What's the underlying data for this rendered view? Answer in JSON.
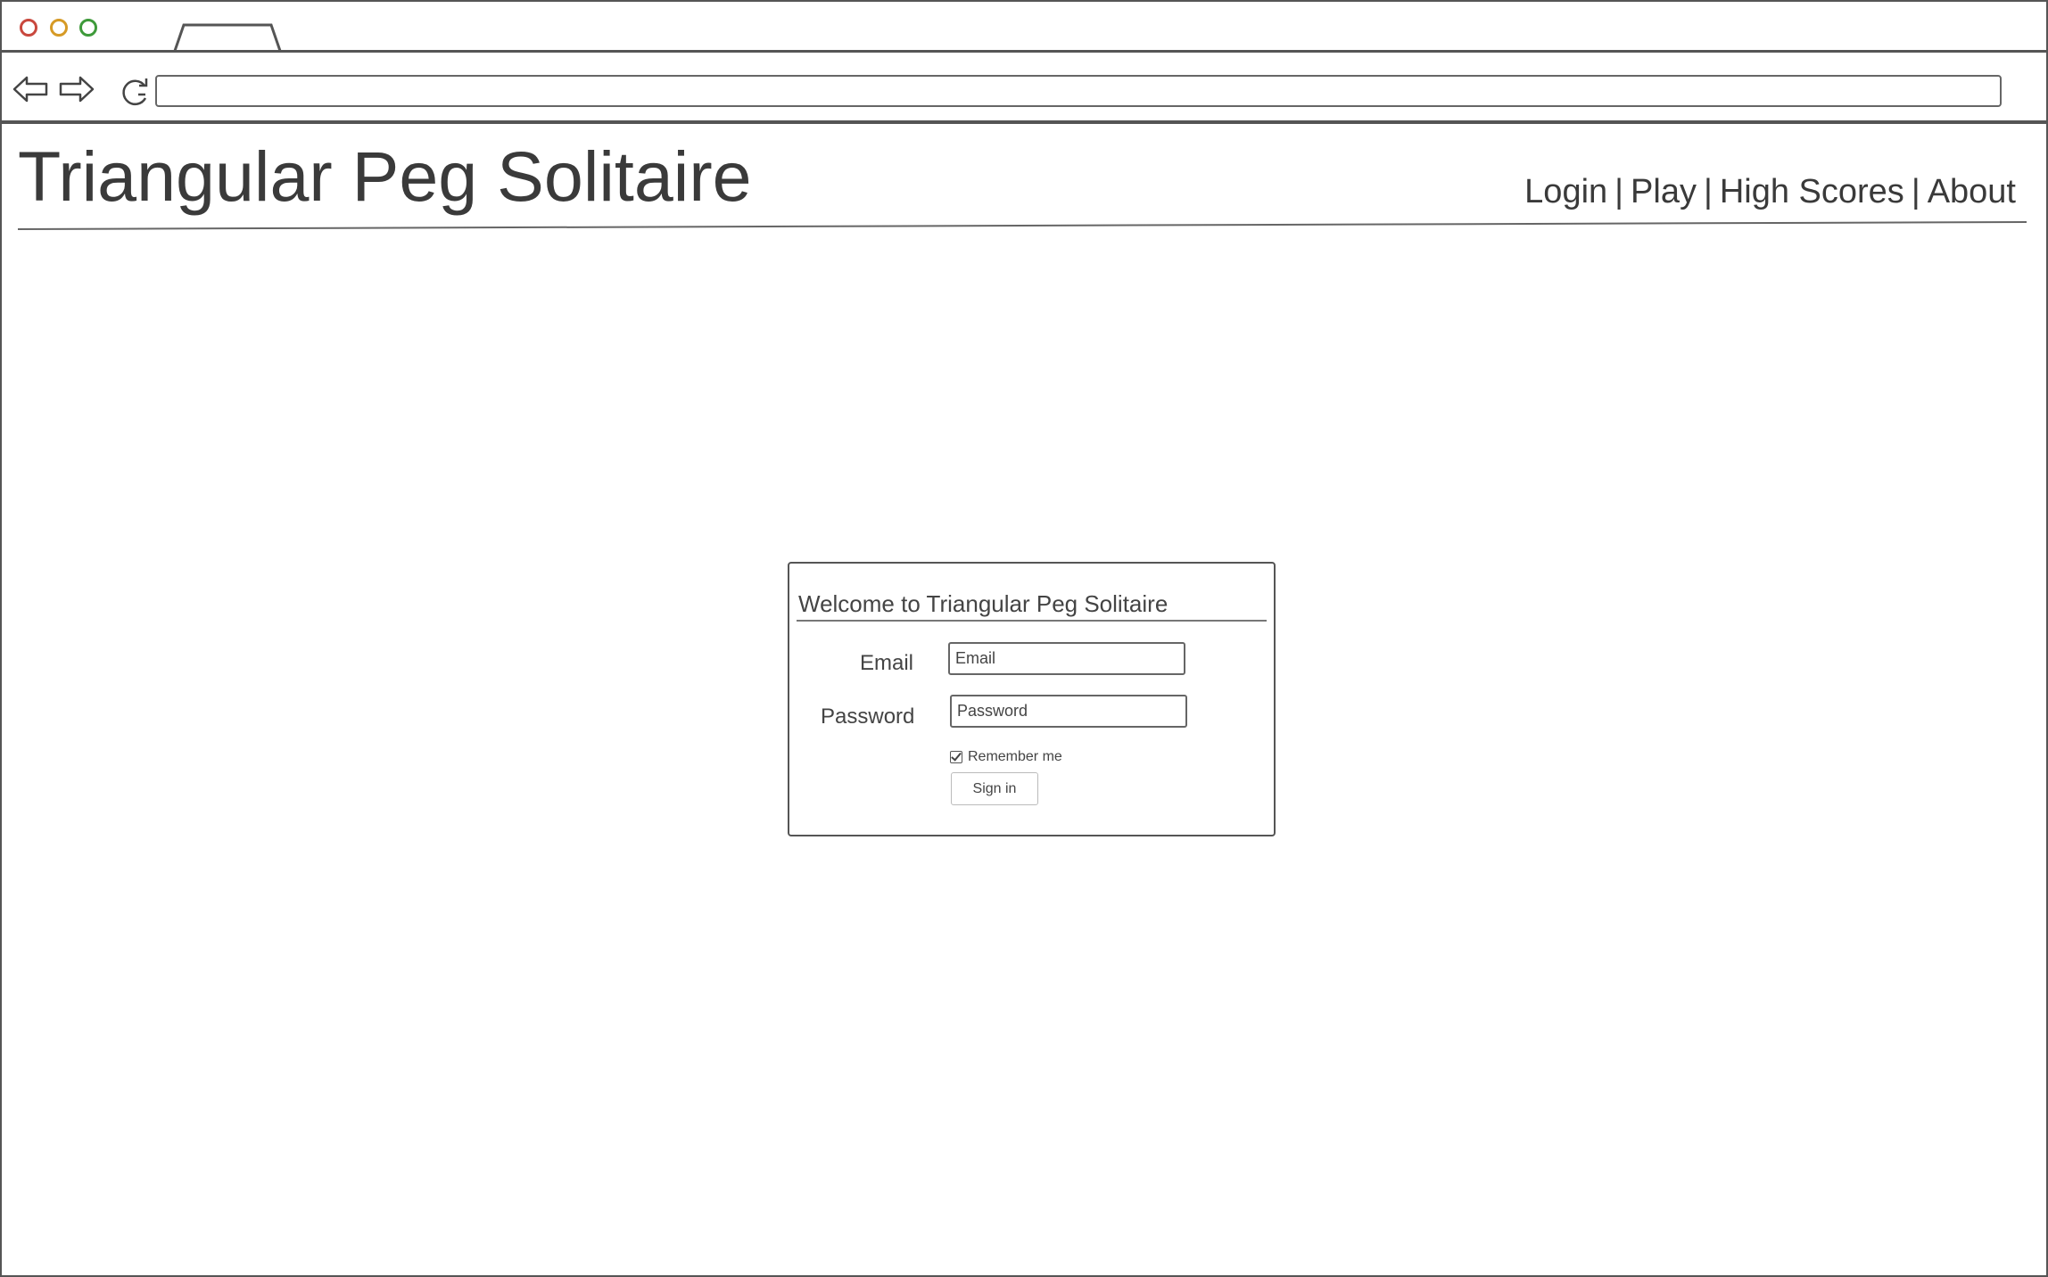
{
  "site": {
    "title": "Triangular Peg Solitaire",
    "nav": [
      "Login",
      "Play",
      "High Scores",
      "About"
    ],
    "nav_separator": "|"
  },
  "login": {
    "heading": "Welcome to Triangular Peg Solitaire",
    "email_label": "Email",
    "email_placeholder": "Email",
    "password_label": "Password",
    "password_placeholder": "Password",
    "remember_label": "Remember me",
    "remember_checked": true,
    "signin_label": "Sign in"
  },
  "browser": {
    "url": ""
  }
}
